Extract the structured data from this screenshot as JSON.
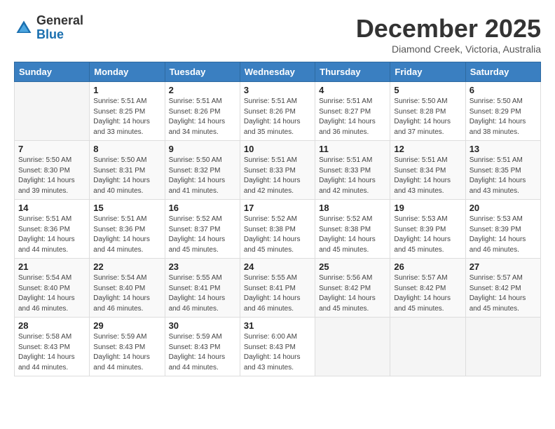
{
  "header": {
    "logo": {
      "general": "General",
      "blue": "Blue"
    },
    "title": "December 2025",
    "location": "Diamond Creek, Victoria, Australia"
  },
  "weekdays": [
    "Sunday",
    "Monday",
    "Tuesday",
    "Wednesday",
    "Thursday",
    "Friday",
    "Saturday"
  ],
  "weeks": [
    [
      {
        "day": "",
        "info": ""
      },
      {
        "day": "1",
        "info": "Sunrise: 5:51 AM\nSunset: 8:25 PM\nDaylight: 14 hours\nand 33 minutes."
      },
      {
        "day": "2",
        "info": "Sunrise: 5:51 AM\nSunset: 8:26 PM\nDaylight: 14 hours\nand 34 minutes."
      },
      {
        "day": "3",
        "info": "Sunrise: 5:51 AM\nSunset: 8:26 PM\nDaylight: 14 hours\nand 35 minutes."
      },
      {
        "day": "4",
        "info": "Sunrise: 5:51 AM\nSunset: 8:27 PM\nDaylight: 14 hours\nand 36 minutes."
      },
      {
        "day": "5",
        "info": "Sunrise: 5:50 AM\nSunset: 8:28 PM\nDaylight: 14 hours\nand 37 minutes."
      },
      {
        "day": "6",
        "info": "Sunrise: 5:50 AM\nSunset: 8:29 PM\nDaylight: 14 hours\nand 38 minutes."
      }
    ],
    [
      {
        "day": "7",
        "info": "Sunrise: 5:50 AM\nSunset: 8:30 PM\nDaylight: 14 hours\nand 39 minutes."
      },
      {
        "day": "8",
        "info": "Sunrise: 5:50 AM\nSunset: 8:31 PM\nDaylight: 14 hours\nand 40 minutes."
      },
      {
        "day": "9",
        "info": "Sunrise: 5:50 AM\nSunset: 8:32 PM\nDaylight: 14 hours\nand 41 minutes."
      },
      {
        "day": "10",
        "info": "Sunrise: 5:51 AM\nSunset: 8:33 PM\nDaylight: 14 hours\nand 42 minutes."
      },
      {
        "day": "11",
        "info": "Sunrise: 5:51 AM\nSunset: 8:33 PM\nDaylight: 14 hours\nand 42 minutes."
      },
      {
        "day": "12",
        "info": "Sunrise: 5:51 AM\nSunset: 8:34 PM\nDaylight: 14 hours\nand 43 minutes."
      },
      {
        "day": "13",
        "info": "Sunrise: 5:51 AM\nSunset: 8:35 PM\nDaylight: 14 hours\nand 43 minutes."
      }
    ],
    [
      {
        "day": "14",
        "info": "Sunrise: 5:51 AM\nSunset: 8:36 PM\nDaylight: 14 hours\nand 44 minutes."
      },
      {
        "day": "15",
        "info": "Sunrise: 5:51 AM\nSunset: 8:36 PM\nDaylight: 14 hours\nand 44 minutes."
      },
      {
        "day": "16",
        "info": "Sunrise: 5:52 AM\nSunset: 8:37 PM\nDaylight: 14 hours\nand 45 minutes."
      },
      {
        "day": "17",
        "info": "Sunrise: 5:52 AM\nSunset: 8:38 PM\nDaylight: 14 hours\nand 45 minutes."
      },
      {
        "day": "18",
        "info": "Sunrise: 5:52 AM\nSunset: 8:38 PM\nDaylight: 14 hours\nand 45 minutes."
      },
      {
        "day": "19",
        "info": "Sunrise: 5:53 AM\nSunset: 8:39 PM\nDaylight: 14 hours\nand 45 minutes."
      },
      {
        "day": "20",
        "info": "Sunrise: 5:53 AM\nSunset: 8:39 PM\nDaylight: 14 hours\nand 46 minutes."
      }
    ],
    [
      {
        "day": "21",
        "info": "Sunrise: 5:54 AM\nSunset: 8:40 PM\nDaylight: 14 hours\nand 46 minutes."
      },
      {
        "day": "22",
        "info": "Sunrise: 5:54 AM\nSunset: 8:40 PM\nDaylight: 14 hours\nand 46 minutes."
      },
      {
        "day": "23",
        "info": "Sunrise: 5:55 AM\nSunset: 8:41 PM\nDaylight: 14 hours\nand 46 minutes."
      },
      {
        "day": "24",
        "info": "Sunrise: 5:55 AM\nSunset: 8:41 PM\nDaylight: 14 hours\nand 46 minutes."
      },
      {
        "day": "25",
        "info": "Sunrise: 5:56 AM\nSunset: 8:42 PM\nDaylight: 14 hours\nand 45 minutes."
      },
      {
        "day": "26",
        "info": "Sunrise: 5:57 AM\nSunset: 8:42 PM\nDaylight: 14 hours\nand 45 minutes."
      },
      {
        "day": "27",
        "info": "Sunrise: 5:57 AM\nSunset: 8:42 PM\nDaylight: 14 hours\nand 45 minutes."
      }
    ],
    [
      {
        "day": "28",
        "info": "Sunrise: 5:58 AM\nSunset: 8:43 PM\nDaylight: 14 hours\nand 44 minutes."
      },
      {
        "day": "29",
        "info": "Sunrise: 5:59 AM\nSunset: 8:43 PM\nDaylight: 14 hours\nand 44 minutes."
      },
      {
        "day": "30",
        "info": "Sunrise: 5:59 AM\nSunset: 8:43 PM\nDaylight: 14 hours\nand 44 minutes."
      },
      {
        "day": "31",
        "info": "Sunrise: 6:00 AM\nSunset: 8:43 PM\nDaylight: 14 hours\nand 43 minutes."
      },
      {
        "day": "",
        "info": ""
      },
      {
        "day": "",
        "info": ""
      },
      {
        "day": "",
        "info": ""
      }
    ]
  ]
}
